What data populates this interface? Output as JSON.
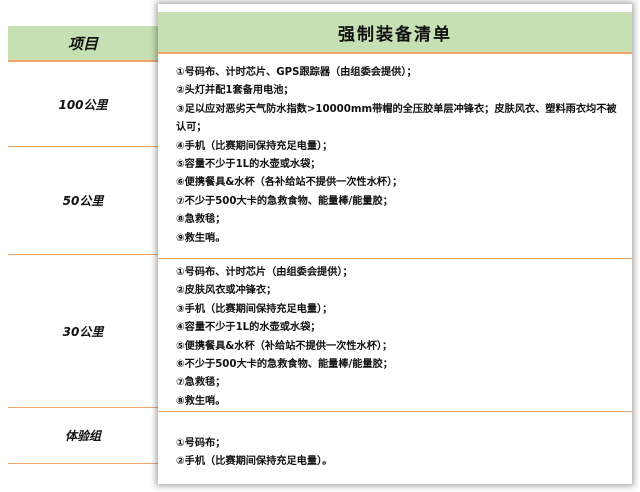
{
  "left": {
    "header": "项目",
    "rows": [
      "100公里",
      "50公里",
      "30公里",
      "体验组"
    ]
  },
  "panel": {
    "title": "强制装备清单",
    "sections": [
      {
        "items": [
          "①号码布、计时芯片、GPS跟踪器（由组委会提供）；",
          "②头灯并配1套备用电池；",
          "③足以应对恶劣天气防水指数>10000mm带帽的全压胶单层冲锋衣；皮肤风衣、塑料雨衣均不被认可；",
          "④手机（比赛期间保持充足电量）；",
          "⑤容量不少于1L的水壶或水袋；",
          "⑥便携餐具&水杯（各补给站不提供一次性水杯）；",
          "⑦不少于500大卡的急救食物、能量棒/能量胶；",
          "⑧急救毯；",
          "⑨救生哨。"
        ]
      },
      {
        "items": [
          "①号码布、计时芯片（由组委会提供）；",
          "②皮肤风衣或冲锋衣；",
          "③手机（比赛期间保持充足电量）；",
          "④容量不少于1L的水壶或水袋；",
          "⑤便携餐具&水杯（补给站不提供一次性水杯）；",
          "⑥不少于500大卡的急救食物、能量棒/能量胶；",
          "⑦急救毯；",
          "⑧救生哨。"
        ]
      },
      {
        "items": [
          "①号码布；",
          "②手机（比赛期间保持充足电量）。"
        ]
      }
    ]
  },
  "colors": {
    "header_bg": "#c6e0b4",
    "divider": "#f4a36b",
    "text": "#111111"
  }
}
